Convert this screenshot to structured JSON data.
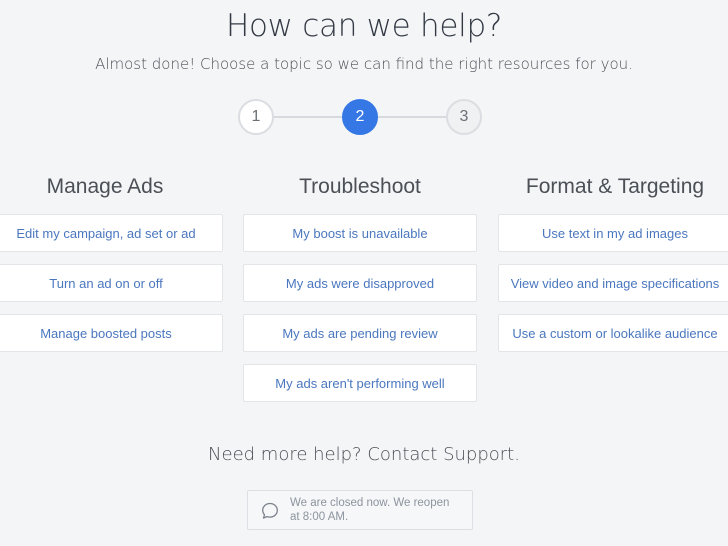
{
  "header": {
    "title": "How can we help?",
    "subtitle": "Almost done! Choose a topic so we can find the right resources for you."
  },
  "stepper": {
    "steps": [
      "1",
      "2",
      "3"
    ],
    "current_step": 2,
    "accent_color": "#3578e5"
  },
  "columns": [
    {
      "title": "Manage Ads",
      "topics": [
        "Edit my campaign, ad set or ad",
        "Turn an ad on or off",
        "Manage boosted posts"
      ]
    },
    {
      "title": "Troubleshoot",
      "topics": [
        "My boost is unavailable",
        "My ads were disapproved",
        "My ads are pending review",
        "My ads aren't performing well"
      ]
    },
    {
      "title": "Format & Targeting",
      "topics": [
        "Use text in my ad images",
        "View video and image specifications",
        "Use a custom or lookalike audience"
      ]
    }
  ],
  "support": {
    "heading": "Need more help? Contact Support.",
    "icon": "chat-bubble-icon",
    "status_line1": "We are closed now. We reopen",
    "status_line2": "at 8:00 AM."
  }
}
